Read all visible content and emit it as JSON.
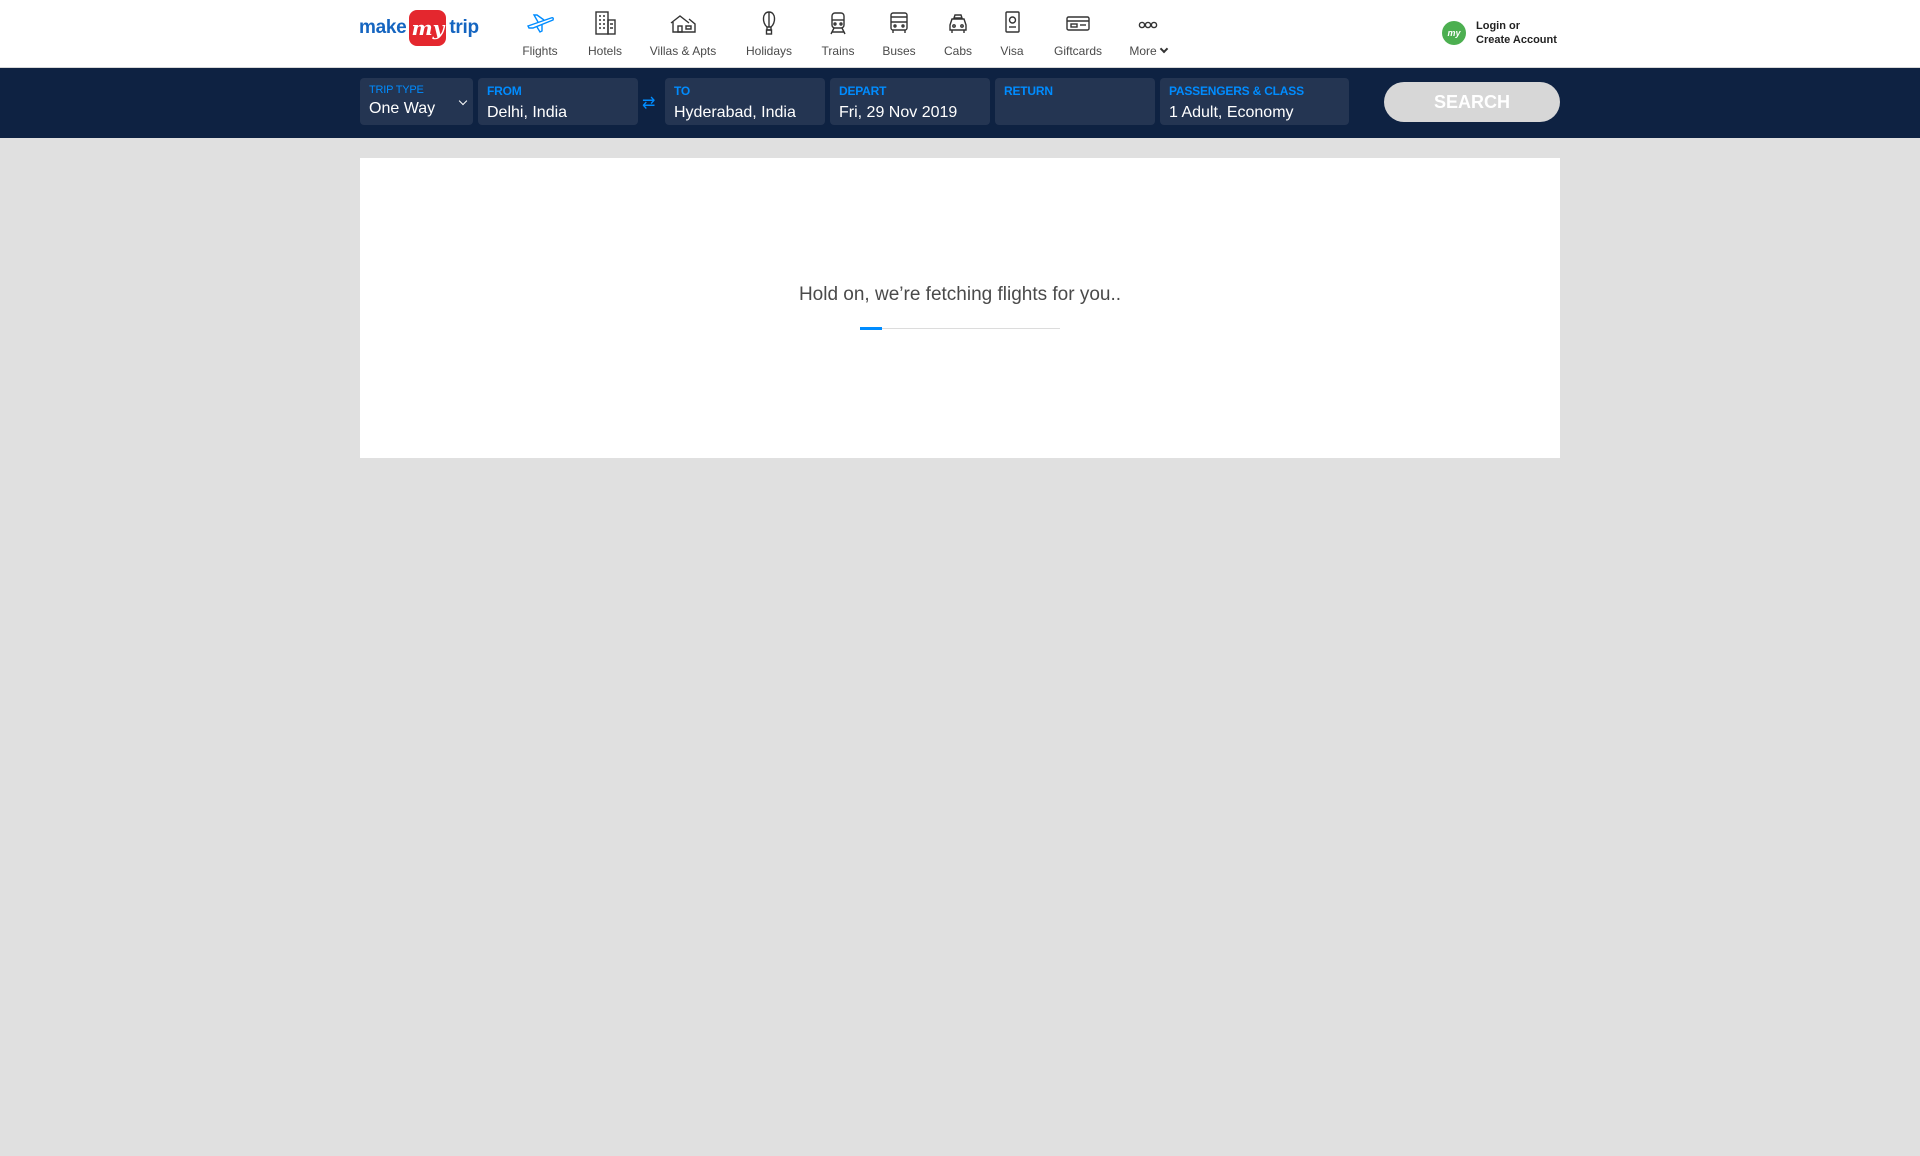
{
  "brand": {
    "make": "make",
    "my": "my",
    "trip": "trip"
  },
  "nav": [
    {
      "label": "Flights",
      "icon": "airplane-icon",
      "active": true
    },
    {
      "label": "Hotels",
      "icon": "hotel-building-icon"
    },
    {
      "label": "Villas & Apts",
      "icon": "villa-house-icon"
    },
    {
      "label": "Holidays",
      "icon": "hot-air-balloon-icon"
    },
    {
      "label": "Trains",
      "icon": "train-icon"
    },
    {
      "label": "Buses",
      "icon": "bus-icon"
    },
    {
      "label": "Cabs",
      "icon": "car-icon"
    },
    {
      "label": "Visa",
      "icon": "passport-icon"
    },
    {
      "label": "Giftcards",
      "icon": "giftcard-icon"
    },
    {
      "label": "More",
      "icon": "more-dots-icon"
    }
  ],
  "login": {
    "line1": "Login or",
    "line2": "Create Account",
    "avatar_text": "my"
  },
  "search": {
    "trip_type": {
      "label": "TRIP TYPE",
      "value": "One Way"
    },
    "from": {
      "label": "FROM",
      "value": "Delhi, India"
    },
    "swap_symbol": "⇄",
    "to": {
      "label": "TO",
      "value": "Hyderabad, India"
    },
    "depart": {
      "label": "DEPART",
      "value": "Fri, 29 Nov 2019"
    },
    "return": {
      "label": "RETURN",
      "value": ""
    },
    "passengers": {
      "label": "PASSENGERS & CLASS",
      "value": "1 Adult, Economy"
    },
    "button_label": "SEARCH"
  },
  "loading": {
    "message": "Hold on, we’re fetching flights for you..",
    "progress_fraction": 0.11
  },
  "colors": {
    "brand_blue": "#1565c0",
    "brand_red": "#e4272e",
    "accent": "#008cff",
    "search_bg": "#0e2242",
    "field_bg": "#243552",
    "page_bg": "#e0e0e0"
  }
}
